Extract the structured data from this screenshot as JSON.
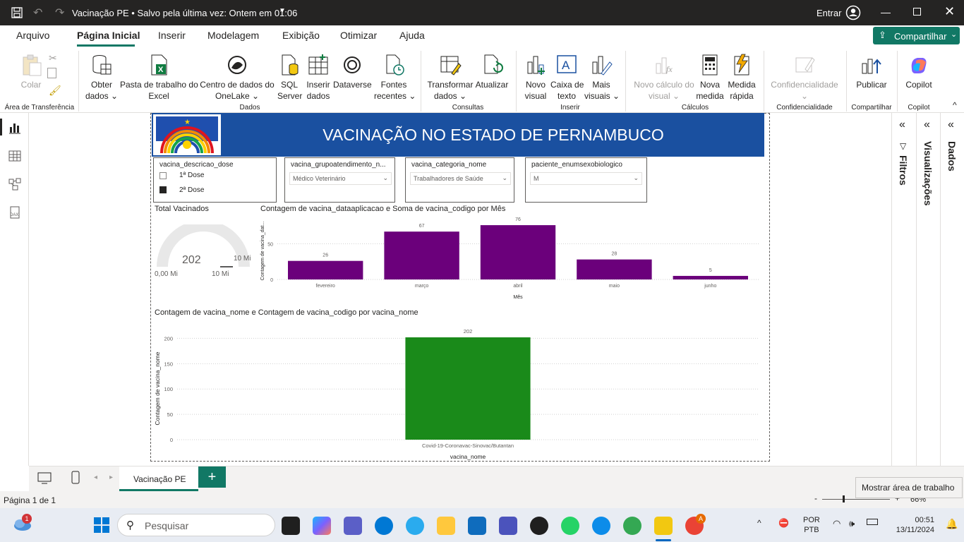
{
  "titlebar": {
    "doc_title": "Vacinação PE • Salvo pela última vez: Ontem em 01:06",
    "signin": "Entrar"
  },
  "menu": [
    "Arquivo",
    "Página Inicial",
    "Inserir",
    "Modelagem",
    "Exibição",
    "Otimizar",
    "Ajuda"
  ],
  "share_label": "Compartilhar",
  "ribbon": {
    "colar": "Colar",
    "obter_dados": [
      "Obter",
      "dados"
    ],
    "pasta_trabalho": [
      "Pasta de trabalho do",
      "Excel"
    ],
    "centro_dados": [
      "Centro de dados do",
      "OneLake"
    ],
    "sql_server": [
      "SQL",
      "Server"
    ],
    "inserir_dados": [
      "Inserir",
      "dados"
    ],
    "dataverse": "Dataverse",
    "fontes_recentes": [
      "Fontes",
      "recentes"
    ],
    "transformar_dados": [
      "Transformar",
      "dados"
    ],
    "atualizar": "Atualizar",
    "novo_visual": [
      "Novo",
      "visual"
    ],
    "caixa_texto": [
      "Caixa de",
      "texto"
    ],
    "mais_visuais": [
      "Mais",
      "visuais"
    ],
    "novo_calculo": [
      "Novo cálculo do",
      "visual"
    ],
    "nova_medida": [
      "Nova",
      "medida"
    ],
    "medida_rapida": [
      "Medida",
      "rápida"
    ],
    "confidencialidade": "Confidencialidade",
    "publicar": "Publicar",
    "copilot": "Copilot",
    "groups": {
      "area_transferencia": "Área de Transferência",
      "dados": "Dados",
      "consultas": "Consultas",
      "inserir": "Inserir",
      "calculos": "Cálculos",
      "confidencialidade": "Confidencialidade",
      "compartilhar": "Compartilhar",
      "copilot": "Copilot"
    }
  },
  "panes": {
    "filtros": "Filtros",
    "visualizacoes": "Visualizações",
    "dados": "Dados"
  },
  "report": {
    "banner_title": "VACINAÇÃO NO ESTADO DE PERNAMBUCO",
    "slicer_dose": {
      "title": "vacina_descricao_dose",
      "options": [
        "1ª Dose",
        "2ª Dose"
      ],
      "checked": [
        false,
        true
      ]
    },
    "slicer_grupo": {
      "title": "vacina_grupoatendimento_n...",
      "value": "Médico Veterinário"
    },
    "slicer_categoria": {
      "title": "vacina_categoria_nome",
      "value": "Trabalhadores de Saúde"
    },
    "slicer_sexo": {
      "title": "paciente_enumsexobiologico",
      "value": "M"
    },
    "gauge": {
      "title": "Total Vacinados",
      "value": "202",
      "min_label": "0,00 Mi",
      "max_label": "10 Mi",
      "target_label": "10 Mi",
      "fraction": 2e-05
    }
  },
  "chart_data": [
    {
      "type": "bar",
      "title": "Contagem de vacina_dataaplicacao e Soma de vacina_codigo por Mês",
      "xlabel": "Mês",
      "ylabel": "Contagem de vacina_dat...",
      "categories": [
        "fevereiro",
        "março",
        "abril",
        "maio",
        "junho"
      ],
      "values": [
        26,
        67,
        76,
        28,
        5
      ],
      "ylim": [
        0,
        80
      ],
      "yticks": [
        0,
        50
      ],
      "color": "#6b007b"
    },
    {
      "type": "bar",
      "title": "Contagem de vacina_nome e Contagem de vacina_codigo por vacina_nome",
      "xlabel": "vacina_nome",
      "ylabel": "Contagem de vacina_nome",
      "categories": [
        "Covid-19-Coronavac-Sinovac/Butantan"
      ],
      "values": [
        202
      ],
      "ylim": [
        0,
        202
      ],
      "yticks": [
        0,
        50,
        100,
        150,
        200
      ],
      "color": "#1a8a1a"
    }
  ],
  "tabs": {
    "page_name": "Vacinação PE"
  },
  "status": {
    "page": "Página 1 de 1",
    "tooltip": "Mostrar área de trabalho",
    "zoom": "66%"
  },
  "taskbar": {
    "search": "Pesquisar",
    "lang1": "POR",
    "lang2": "PTB",
    "time": "00:51",
    "date": "13/11/2024",
    "weather_badge": "1",
    "chrome_badge": "A"
  }
}
